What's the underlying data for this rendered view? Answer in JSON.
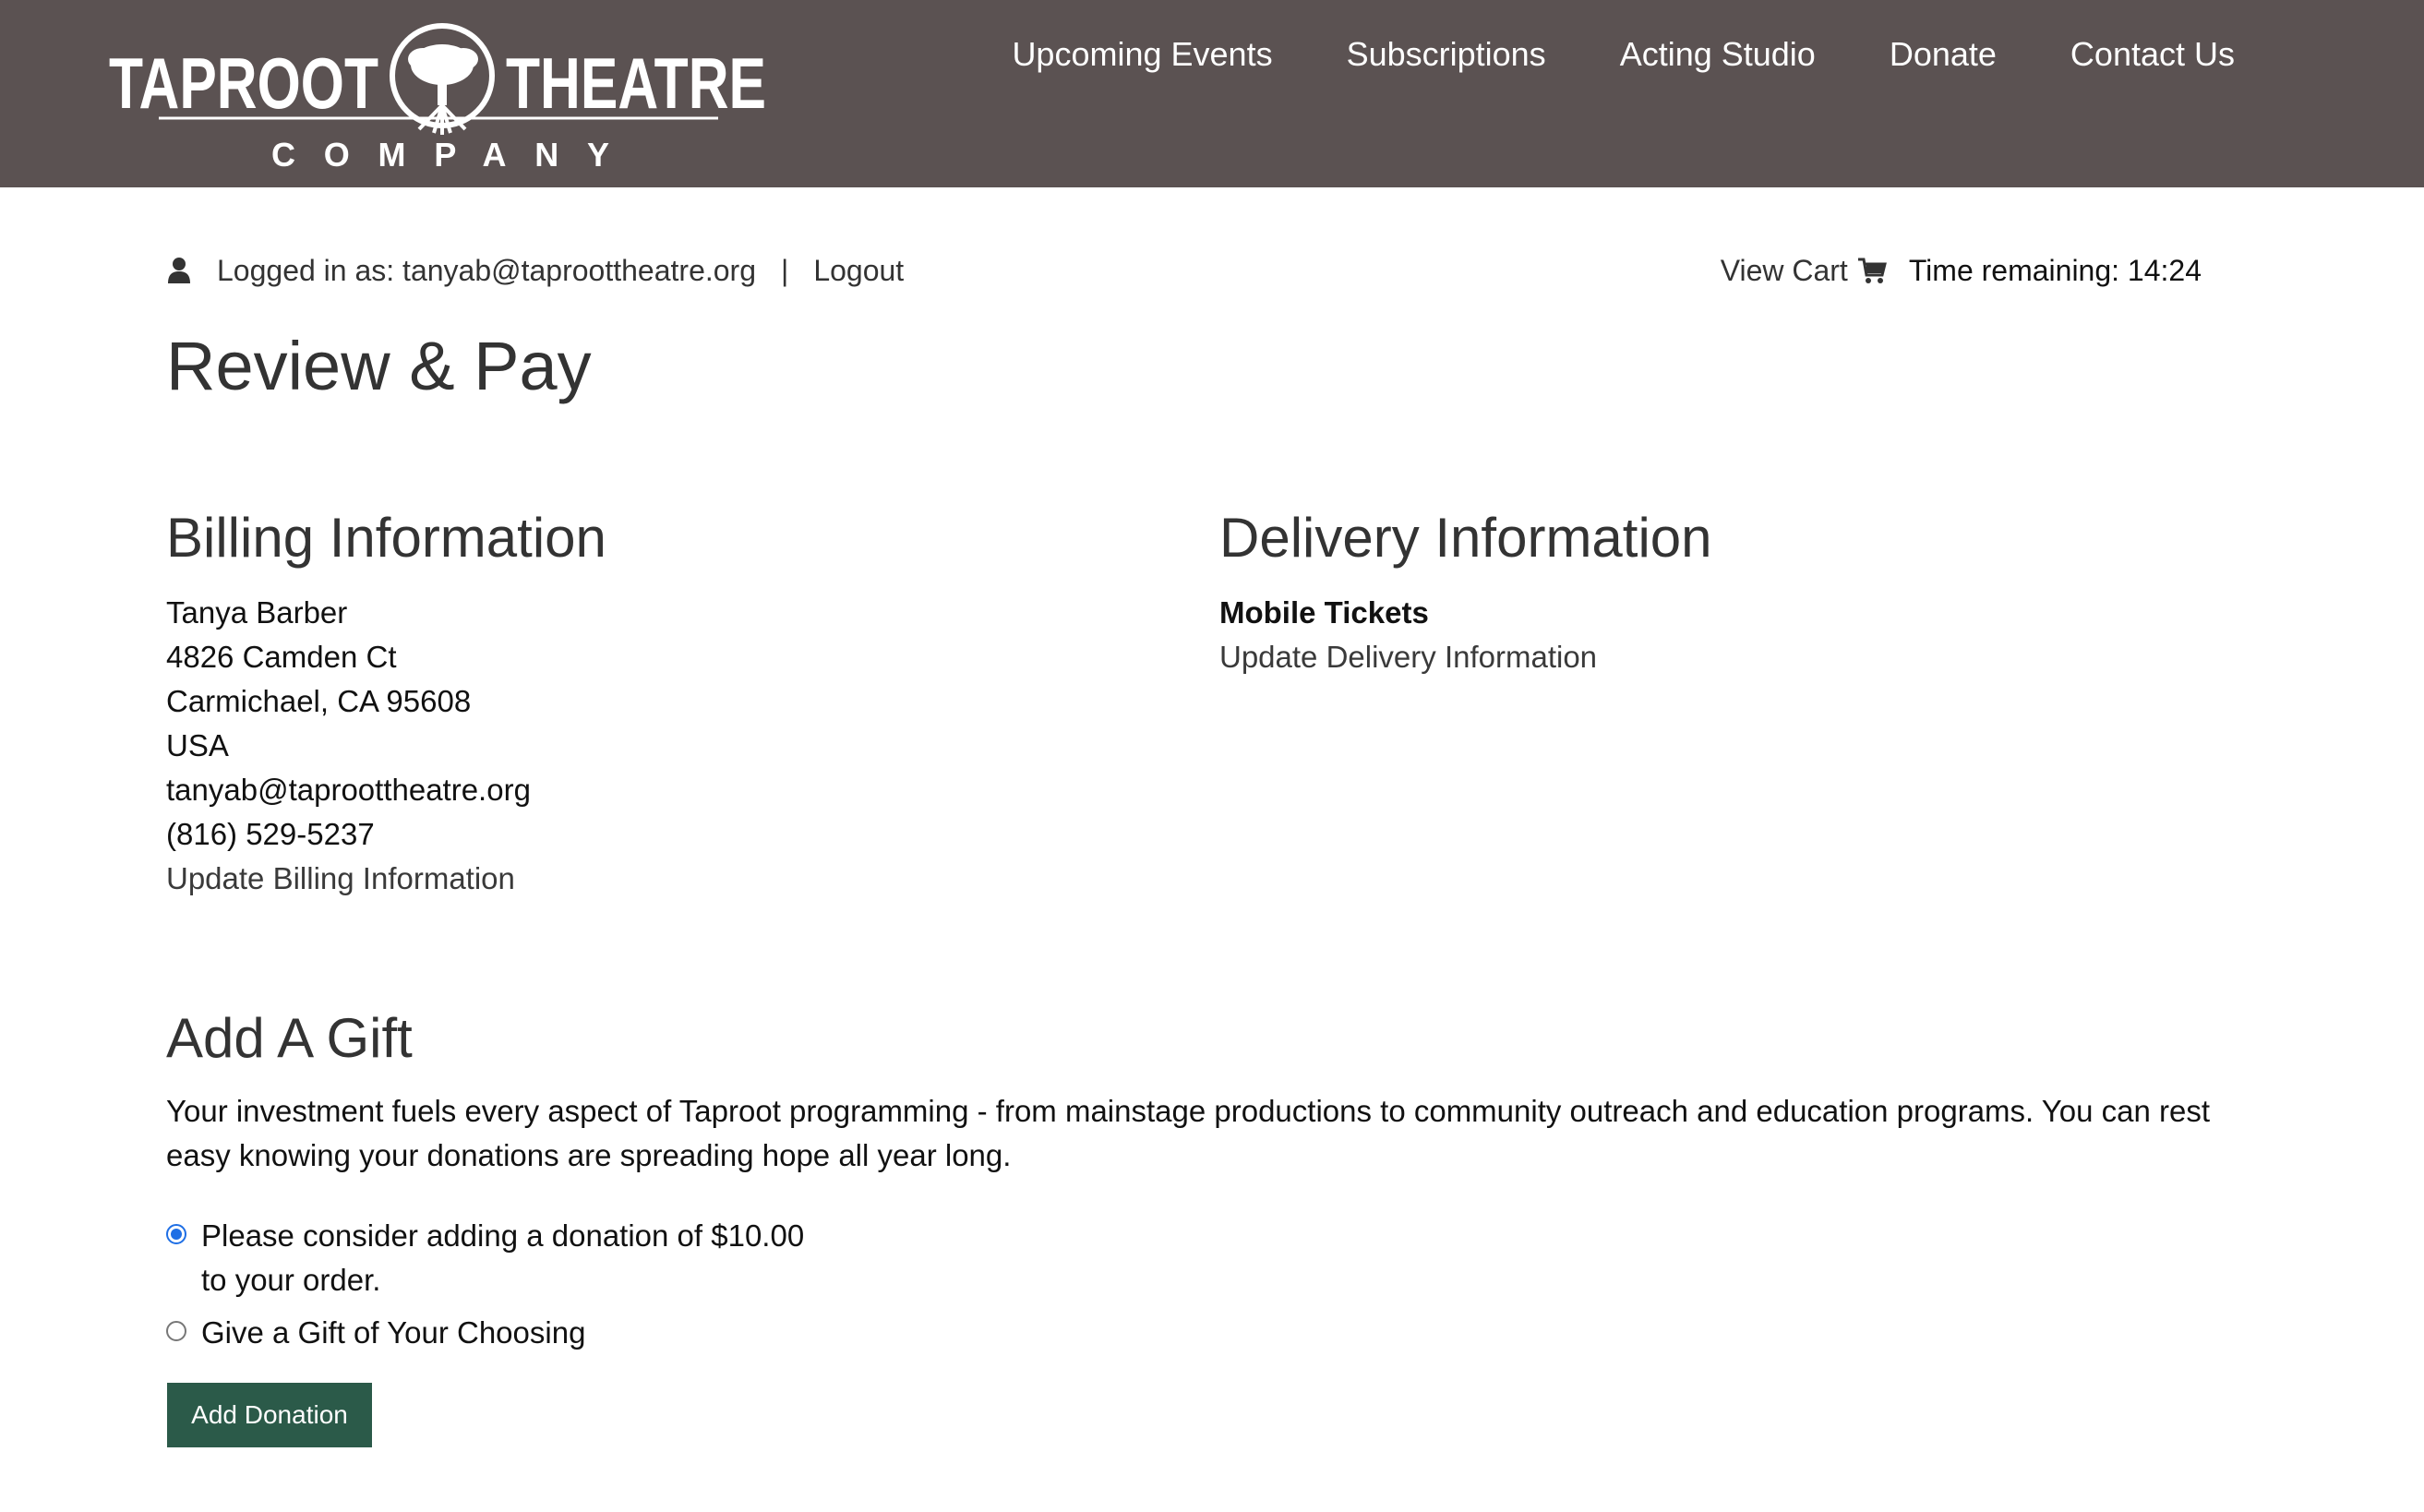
{
  "brand": {
    "name_line1_left": "TAPROOT",
    "name_line1_right": "THEATRE",
    "name_line2": "COMPANY",
    "color_header": "#5b5252",
    "color_button": "#2b5a49"
  },
  "nav": {
    "items": [
      {
        "label": "Upcoming Events"
      },
      {
        "label": "Subscriptions"
      },
      {
        "label": "Acting Studio"
      },
      {
        "label": "Donate"
      },
      {
        "label": "Contact Us"
      }
    ]
  },
  "userbar": {
    "user_icon": "user-icon",
    "logged_in_text": "Logged in as: tanyab@taproottheatre.org",
    "separator": "|",
    "logout_label": "Logout",
    "view_cart_label": "View Cart",
    "cart_icon": "cart-icon",
    "time_remaining": "Time remaining: 14:24"
  },
  "page": {
    "title": "Review & Pay"
  },
  "billing": {
    "title": "Billing Information",
    "name": "Tanya Barber",
    "address1": "4826 Camden Ct",
    "city_line": "Carmichael, CA 95608",
    "country": "USA",
    "email": "tanyab@taproottheatre.org",
    "phone": "(816) 529-5237",
    "update_link": "Update Billing Information"
  },
  "delivery": {
    "title": "Delivery Information",
    "method": "Mobile Tickets",
    "update_link": "Update Delivery Information"
  },
  "gift": {
    "title": "Add A Gift",
    "description": "Your investment fuels every aspect of Taproot programming - from mainstage productions to community outreach and education programs. You can rest easy knowing your donations are spreading hope all year long.",
    "option1_line1": "Please consider adding a donation of $10.00",
    "option1_line2": "to your order.",
    "option1_selected": true,
    "option2_label": "Give a Gift of Your Choosing",
    "option2_selected": false,
    "button_label": "Add Donation"
  }
}
